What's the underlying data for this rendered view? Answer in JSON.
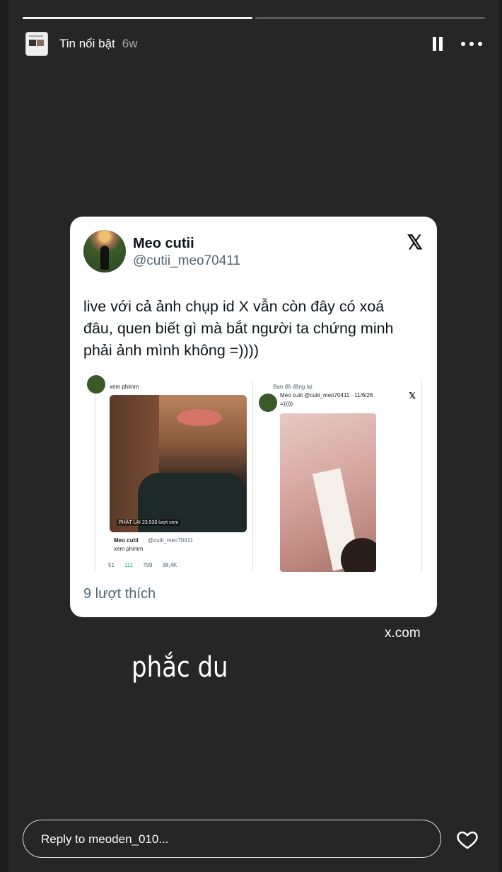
{
  "story": {
    "progress": [
      1,
      0
    ],
    "account_name": "Tin nổi bật",
    "time_ago": "6w"
  },
  "tweet": {
    "name": "Meo cutii",
    "handle": "@cutii_meo70411",
    "text": "live với cả ảnh chụp id X vẫn còn đây có xoá đâu, quen biết gì mà bắt người ta chứng minh phải ảnh mình không =))))",
    "likes": "9 lượt thích",
    "embedded": {
      "left_top_caption": "xem phimm",
      "video_overlay": "PHÁT LẠI  23.530 lượt xem",
      "left_name": "Meo cutii",
      "left_handle": "@cutii_meo70411",
      "left_text": "xem phimm",
      "left_stats": [
        "51",
        "111",
        "799",
        "38,4K"
      ],
      "right_repost": "Bạn đã đăng lại",
      "right_header": "Meo cutii  @cutii_meo70411 · 11/6/26",
      "right_text": "=)))))"
    }
  },
  "source": "x.com",
  "caption": "phắc du",
  "reply": {
    "placeholder": "Reply to meoden_010..."
  },
  "icons": {
    "pause": "pause-icon",
    "more": "more-icon",
    "x_logo": "x-logo-icon",
    "heart": "heart-icon"
  }
}
